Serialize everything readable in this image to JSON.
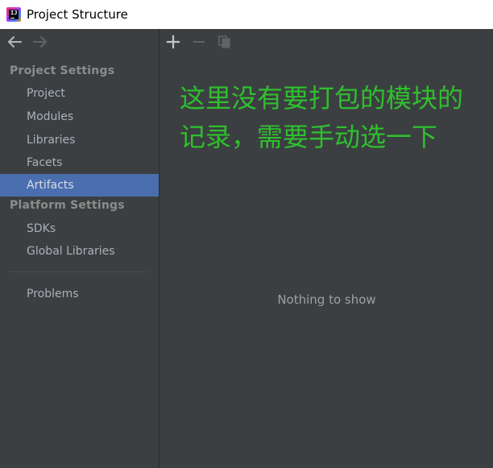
{
  "window": {
    "title": "Project Structure",
    "app_icon": "intellij-idea-icon"
  },
  "sidebar": {
    "nav": {
      "back_icon": "arrow-left-icon",
      "forward_icon": "arrow-right-icon"
    },
    "sections": [
      {
        "header": "Project Settings",
        "items": [
          {
            "label": "Project"
          },
          {
            "label": "Modules"
          },
          {
            "label": "Libraries"
          },
          {
            "label": "Facets"
          },
          {
            "label": "Artifacts",
            "selected": true
          }
        ]
      },
      {
        "header": "Platform Settings",
        "items": [
          {
            "label": "SDKs"
          },
          {
            "label": "Global Libraries"
          }
        ]
      }
    ],
    "problems_label": "Problems"
  },
  "main": {
    "toolbar": {
      "add_icon": "plus-icon",
      "remove_icon": "minus-icon",
      "copy_icon": "copy-icon"
    },
    "annotation": "这里没有要打包的模块的记录，需要手动选一下",
    "empty_text": "Nothing to show"
  },
  "colors": {
    "background": "#3c3f41",
    "selection": "#4b6eaf",
    "annotation": "#2fbf2f",
    "titlebar": "#ffffff"
  }
}
